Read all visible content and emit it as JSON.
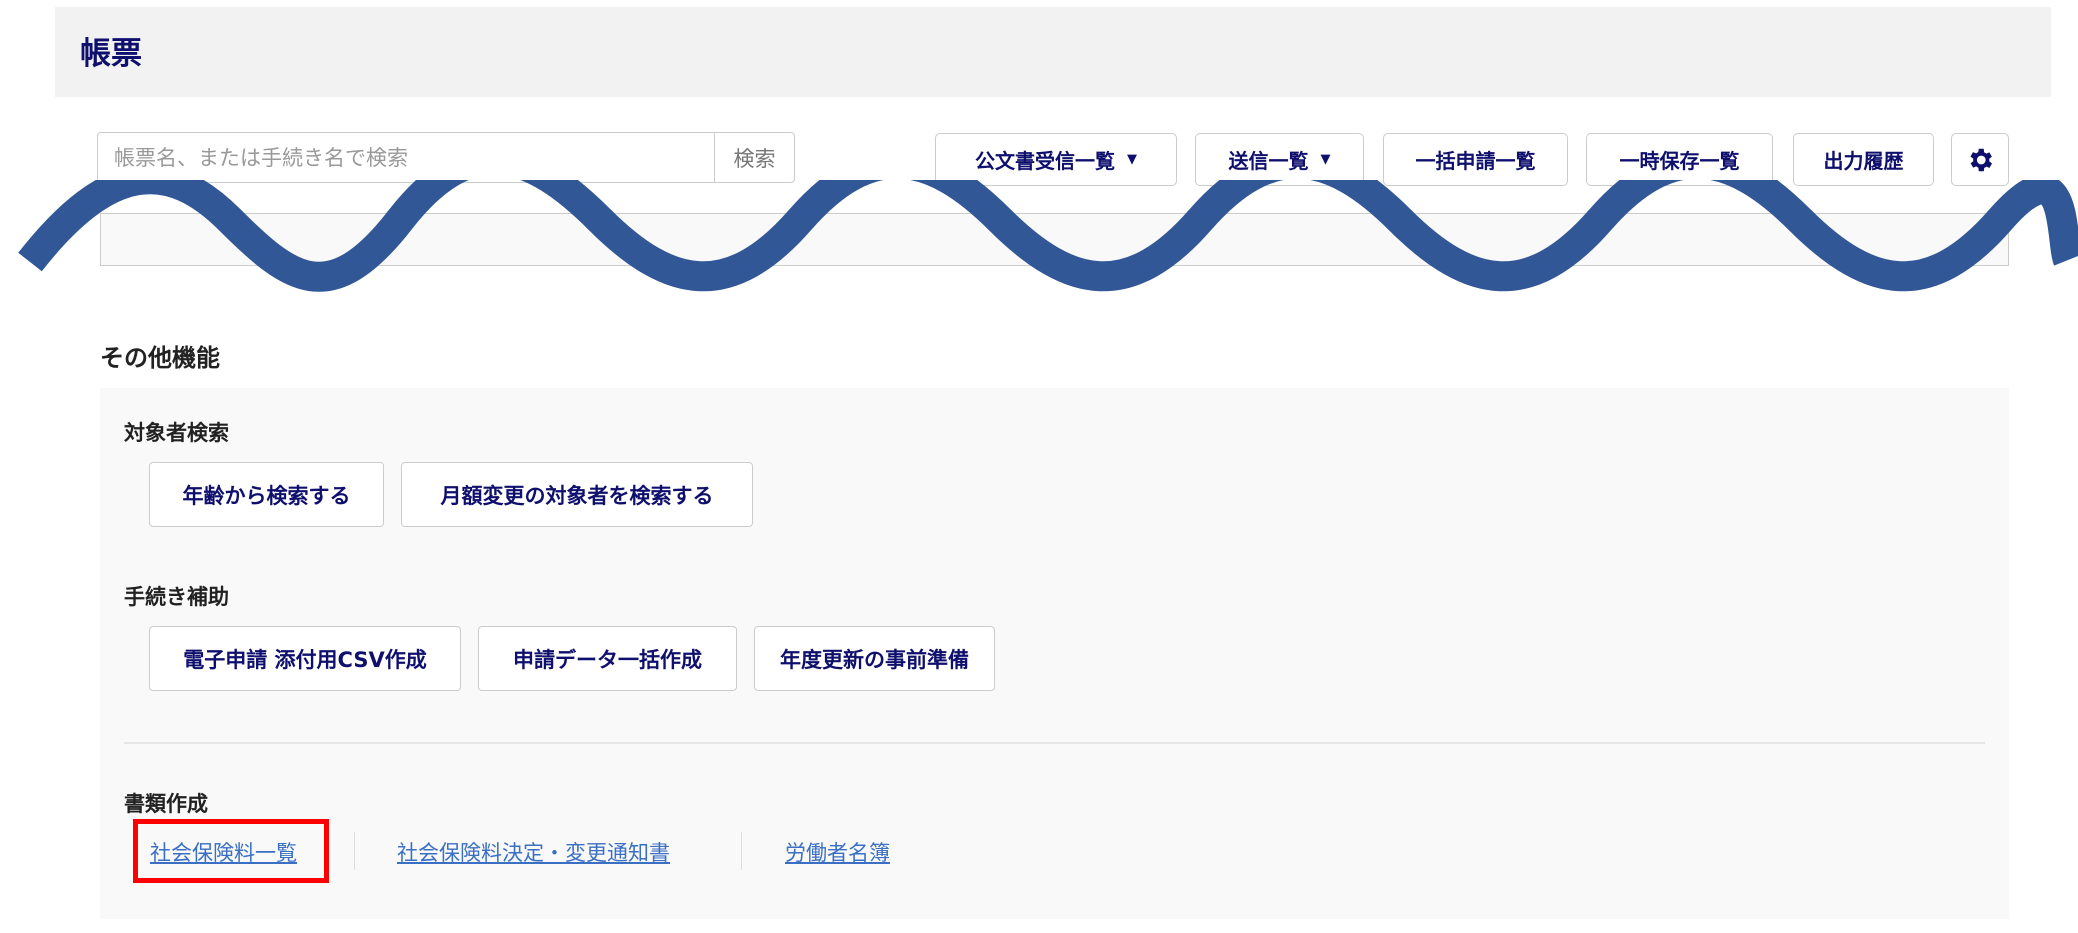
{
  "header": {
    "title": "帳票"
  },
  "search": {
    "placeholder": "帳票名、または手続き名で検索",
    "button": "検索"
  },
  "toolbar": {
    "official_docs": "公文書受信一覧",
    "sent": "送信一覧",
    "bulk": "一括申請一覧",
    "temp_saved": "一時保存一覧",
    "output_history": "出力履歴",
    "settings_icon": "gear-icon"
  },
  "other": {
    "title": "その他機能",
    "target_search": {
      "label": "対象者検索",
      "buttons": [
        "年齢から検索する",
        "月額変更の対象者を検索する"
      ]
    },
    "procedure_aid": {
      "label": "手続き補助",
      "buttons": [
        "電子申請 添付用CSV作成",
        "申請データ一括作成",
        "年度更新の事前準備"
      ]
    },
    "documents": {
      "label": "書類作成",
      "links": [
        "社会保険料一覧",
        "社会保険料決定・変更通知書",
        "労働者名簿"
      ]
    }
  },
  "colors": {
    "accent": "#0f0f6e",
    "link": "#3a6fc4",
    "highlight": "#ff0000",
    "wave": "#315796"
  }
}
